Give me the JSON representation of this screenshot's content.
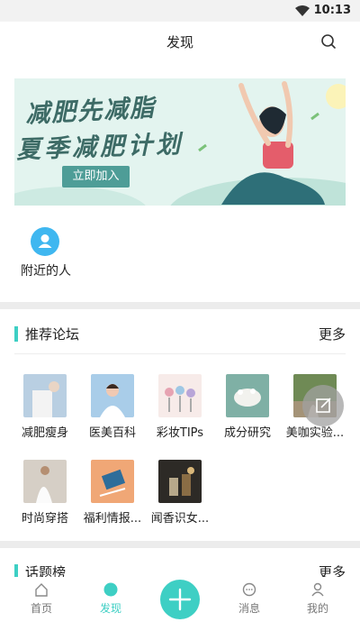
{
  "status": {
    "time": "10:13"
  },
  "header": {
    "title": "发现"
  },
  "banner": {
    "line1": "减肥先减脂",
    "line2": "夏季减肥计划",
    "cta": "立即加入"
  },
  "nearby": {
    "label": "附近的人"
  },
  "forums": {
    "title": "推荐论坛",
    "more": "更多",
    "items": [
      {
        "label": "减肥瘦身"
      },
      {
        "label": "医美百科"
      },
      {
        "label": "彩妆TIPs"
      },
      {
        "label": "成分研究"
      },
      {
        "label": "美咖实验..."
      },
      {
        "label": "时尚穿搭"
      },
      {
        "label": "福利情报..."
      },
      {
        "label": "闻香识女..."
      }
    ]
  },
  "topics": {
    "title": "话题榜",
    "more": "更多"
  },
  "tabs": [
    {
      "label": "首页"
    },
    {
      "label": "发现"
    },
    {
      "label": "消息"
    },
    {
      "label": "我的"
    }
  ],
  "colors": {
    "accent": "#3ecfc4",
    "avatar_blue": "#3fb7f0",
    "banner_text": "#3d6b66",
    "banner_button": "#4e9d97"
  }
}
